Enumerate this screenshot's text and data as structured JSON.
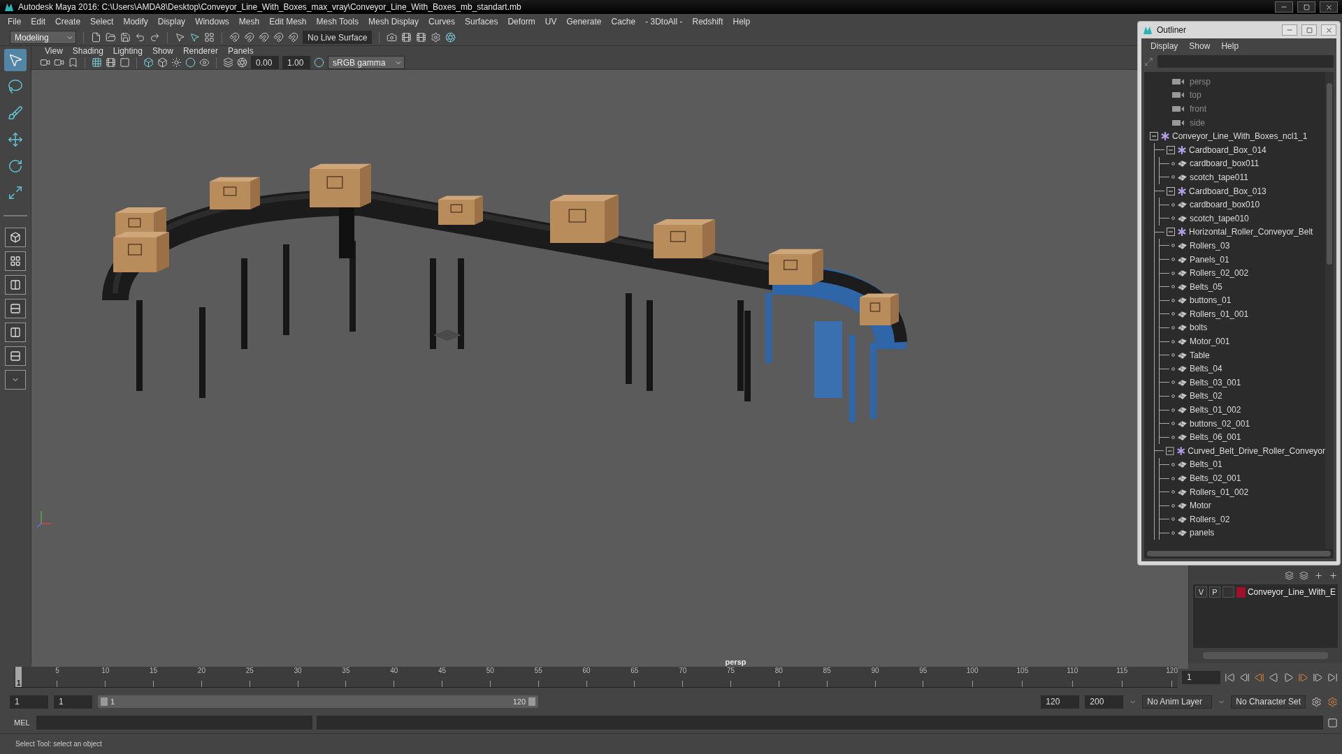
{
  "window": {
    "title": "Autodesk Maya 2016: C:\\Users\\AMDA8\\Desktop\\Conveyor_Line_With_Boxes_max_vray\\Conveyor_Line_With_Boxes_mb_standart.mb"
  },
  "menu_bar": [
    "File",
    "Edit",
    "Create",
    "Select",
    "Modify",
    "Display",
    "Windows",
    "Mesh",
    "Edit Mesh",
    "Mesh Tools",
    "Mesh Display",
    "Curves",
    "Surfaces",
    "Deform",
    "UV",
    "Generate",
    "Cache",
    "- 3DtoAll -",
    "Redshift",
    "Help"
  ],
  "shelf": {
    "workspace": "Modeling",
    "live_surface": "No Live Surface"
  },
  "toolbox": {
    "tools": [
      {
        "selected": true
      },
      {
        "selected": false
      },
      {
        "selected": false
      },
      {
        "selected": false
      },
      {
        "selected": false
      },
      {
        "selected": false
      }
    ]
  },
  "panel": {
    "menus": [
      "View",
      "Shading",
      "Lighting",
      "Show",
      "Renderer",
      "Panels"
    ],
    "field_1": "0.00",
    "field_2": "1.00",
    "color_space": "sRGB gamma",
    "camera_label": "persp"
  },
  "outliner": {
    "title": "Outliner",
    "menus": [
      "Display",
      "Show",
      "Help"
    ],
    "tree": [
      {
        "label": "persp",
        "kind": "camera"
      },
      {
        "label": "top",
        "kind": "camera"
      },
      {
        "label": "front",
        "kind": "camera"
      },
      {
        "label": "side",
        "kind": "camera"
      },
      {
        "label": "Conveyor_Line_With_Boxes_ncl1_1",
        "kind": "group",
        "expanded": true,
        "children": [
          {
            "label": "Cardboard_Box_014",
            "kind": "group",
            "expanded": true,
            "children": [
              {
                "label": "cardboard_box011",
                "kind": "mesh"
              },
              {
                "label": "scotch_tape011",
                "kind": "mesh"
              }
            ]
          },
          {
            "label": "Cardboard_Box_013",
            "kind": "group",
            "expanded": true,
            "children": [
              {
                "label": "cardboard_box010",
                "kind": "mesh"
              },
              {
                "label": "scotch_tape010",
                "kind": "mesh"
              }
            ]
          },
          {
            "label": "Horizontal_Roller_Conveyor_Belt",
            "kind": "group",
            "expanded": true,
            "children": [
              {
                "label": "Rollers_03",
                "kind": "mesh"
              },
              {
                "label": "Panels_01",
                "kind": "mesh"
              },
              {
                "label": "Rollers_02_002",
                "kind": "mesh"
              },
              {
                "label": "Belts_05",
                "kind": "mesh"
              },
              {
                "label": "buttons_01",
                "kind": "mesh"
              },
              {
                "label": "Rollers_01_001",
                "kind": "mesh"
              },
              {
                "label": "bolts",
                "kind": "mesh"
              },
              {
                "label": "Motor_001",
                "kind": "mesh"
              },
              {
                "label": "Table",
                "kind": "mesh"
              },
              {
                "label": "Belts_04",
                "kind": "mesh"
              },
              {
                "label": "Belts_03_001",
                "kind": "mesh"
              },
              {
                "label": "Belts_02",
                "kind": "mesh"
              },
              {
                "label": "Belts_01_002",
                "kind": "mesh"
              },
              {
                "label": "buttons_02_001",
                "kind": "mesh"
              },
              {
                "label": "Belts_06_001",
                "kind": "mesh"
              }
            ]
          },
          {
            "label": "Curved_Belt_Drive_Roller_Conveyor",
            "kind": "group",
            "expanded": true,
            "children": [
              {
                "label": "Belts_01",
                "kind": "mesh"
              },
              {
                "label": "Belts_02_001",
                "kind": "mesh"
              },
              {
                "label": "Rollers_01_002",
                "kind": "mesh"
              },
              {
                "label": "Motor",
                "kind": "mesh"
              },
              {
                "label": "Rollers_02",
                "kind": "mesh"
              },
              {
                "label": "panels",
                "kind": "mesh"
              }
            ]
          }
        ]
      }
    ]
  },
  "layers": [
    {
      "visible": "V",
      "playback": "P",
      "name": "Conveyor_Line_With_E",
      "color": "#a0102a"
    }
  ],
  "timeline": {
    "level": 0,
    "start_label": "1",
    "ticks": [
      "5",
      "10",
      "15",
      "20",
      "25",
      "30",
      "35",
      "40",
      "45",
      "50",
      "55",
      "60",
      "65",
      "70",
      "75",
      "80",
      "85",
      "90",
      "95",
      "100",
      "105",
      "110",
      "115",
      "120"
    ],
    "current_frame": "1"
  },
  "range": {
    "level": 1,
    "start": "1",
    "playback_start": "1",
    "slider_start": "1",
    "slider_end": "120",
    "playback_end": "120",
    "end": "200"
  },
  "anim_layer": "No Anim Layer",
  "character_set": "No Character Set",
  "command_line": {
    "label": "MEL"
  },
  "status": "Select Tool: select an object"
}
